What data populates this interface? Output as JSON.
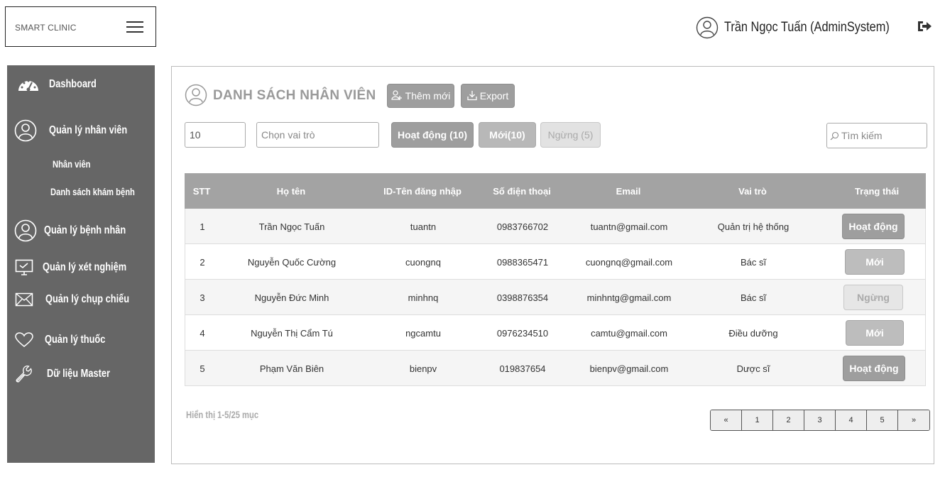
{
  "brand": {
    "name": "SMART CLINIC"
  },
  "user": {
    "name": "Trần Ngọc Tuấn (AdminSystem)"
  },
  "sidebar": {
    "items": [
      {
        "label": "Dashboard",
        "icon": "dashboard-icon"
      },
      {
        "label": "Quản lý nhân viên",
        "icon": "user-icon"
      },
      {
        "label": "Quản lý bệnh nhân",
        "icon": "user-icon"
      },
      {
        "label": "Quản lý xét nghiệm",
        "icon": "monitor-icon"
      },
      {
        "label": "Quản lý chụp chiếu",
        "icon": "envelope-icon"
      },
      {
        "label": "Quản lý thuốc",
        "icon": "heart-icon"
      },
      {
        "label": "Dữ liệu Master",
        "icon": "wrench-icon"
      }
    ],
    "subitems": [
      {
        "label": "Nhân viên"
      },
      {
        "label": "Danh sách khám bệnh"
      }
    ]
  },
  "main": {
    "title": "DANH SÁCH NHÂN VIÊN",
    "add_label": "Thêm mới",
    "export_label": "Export",
    "page_size": "10",
    "role_placeholder": "Chọn vai trò",
    "filters": {
      "active": "Hoạt động (10)",
      "new": "Mới(10)",
      "stopped": "Ngừng (5)"
    },
    "search_placeholder": "Tìm kiếm",
    "columns": [
      "STT",
      "Họ tên",
      "ID-Tên đăng nhập",
      "Số điện thoại",
      "Email",
      "Vai trò",
      "Trạng thái"
    ],
    "rows": [
      {
        "stt": "1",
        "name": "Trần Ngọc Tuấn",
        "username": "tuantn",
        "phone": "0983766702",
        "email": "tuantn@gmail.com",
        "role": "Quản trị hệ thống",
        "status": "Hoạt động"
      },
      {
        "stt": "2",
        "name": "Nguyễn Quốc Cường",
        "username": "cuongnq",
        "phone": "0988365471",
        "email": "cuongnq@gmail.com",
        "role": "Bác sĩ",
        "status": "Mới"
      },
      {
        "stt": "3",
        "name": "Nguyễn Đức Minh",
        "username": "minhnq",
        "phone": "0398876354",
        "email": "minhntg@gmail.com",
        "role": "Bác sĩ",
        "status": "Ngừng"
      },
      {
        "stt": "4",
        "name": "Nguyễn Thị Cẩm Tú",
        "username": "ngcamtu",
        "phone": "0976234510",
        "email": "camtu@gmail.com",
        "role": "Điều dưỡng",
        "status": "Mới"
      },
      {
        "stt": "5",
        "name": "Phạm Văn Biên",
        "username": "bienpv",
        "phone": "019837654",
        "email": "bienpv@gmail.com",
        "role": "Dược sĩ",
        "status": "Hoạt động"
      }
    ],
    "summary": "Hiển thị 1-5/25 mục",
    "pager": [
      "«",
      "1",
      "2",
      "3",
      "4",
      "5",
      "»"
    ]
  }
}
